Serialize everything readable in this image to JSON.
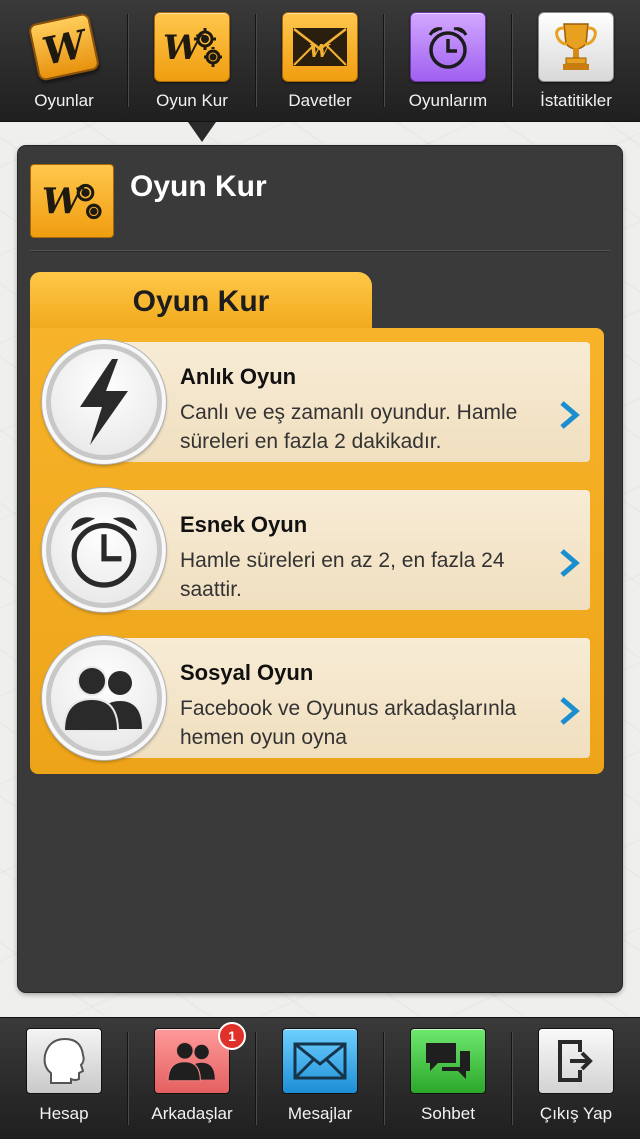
{
  "top_nav": {
    "items": [
      {
        "label": "Oyunlar",
        "icon": "words-tile-icon"
      },
      {
        "label": "Oyun Kur",
        "icon": "gears-icon"
      },
      {
        "label": "Davetler",
        "icon": "envelope-icon"
      },
      {
        "label": "Oyunlarım",
        "icon": "alarm-clock-icon"
      },
      {
        "label": "İstatitikler",
        "icon": "trophy-icon"
      }
    ],
    "active_index": 1
  },
  "panel": {
    "title": "Oyun Kur",
    "header_icon": "gears-icon",
    "tab_label": "Oyun Kur",
    "options": [
      {
        "title": "Anlık Oyun",
        "description": "Canlı ve eş zamanlı oyundur. Hamle süreleri en fazla 2 dakikadır.",
        "icon": "lightning-icon"
      },
      {
        "title": "Esnek Oyun",
        "description": "Hamle süreleri en az 2, en fazla 24 saattir.",
        "icon": "alarm-clock-icon"
      },
      {
        "title": "Sosyal Oyun",
        "description": "Facebook ve Oyunus arkadaşlarınla hemen oyun oyna",
        "icon": "people-icon"
      }
    ]
  },
  "bottom_nav": {
    "items": [
      {
        "label": "Hesap",
        "icon": "head-profile-icon"
      },
      {
        "label": "Arkadaşlar",
        "icon": "people-icon",
        "badge": "1"
      },
      {
        "label": "Mesajlar",
        "icon": "envelope-icon"
      },
      {
        "label": "Sohbet",
        "icon": "chat-bubbles-icon"
      },
      {
        "label": "Çıkış Yap",
        "icon": "exit-icon"
      }
    ]
  },
  "colors": {
    "accent_orange": "#f0a81a",
    "chevron_blue": "#1b8ed0",
    "panel_bg": "#3a3a3a",
    "bar_bg": "#2a2a2a"
  }
}
